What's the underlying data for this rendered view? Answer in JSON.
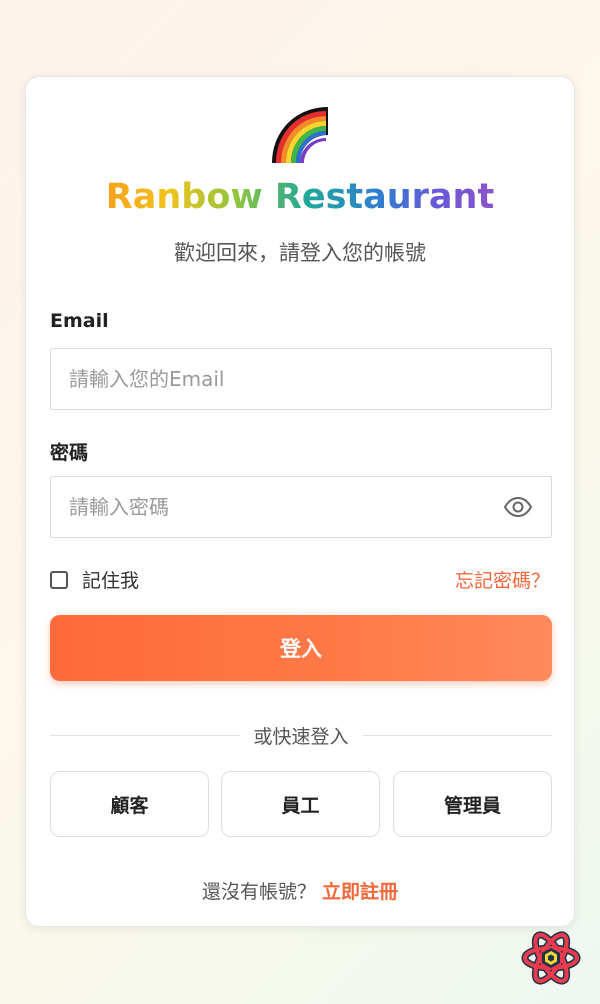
{
  "brand": {
    "name": "Ranbow Restaurant",
    "logo_icon": "rainbow-icon"
  },
  "login": {
    "subtitle": "歡迎回來，請登入您的帳號",
    "email_label": "Email",
    "email_placeholder": "請輸入您的Email",
    "email_value": "",
    "password_label": "密碼",
    "password_placeholder": "請輸入密碼",
    "password_value": "",
    "show_password_icon": "eye-icon",
    "remember_label": "記住我",
    "remember_checked": false,
    "forgot_label": "忘記密碼？",
    "submit_label": "登入"
  },
  "quick_login": {
    "divider_text": "或快速登入",
    "options": [
      {
        "label": "顧客"
      },
      {
        "label": "員工"
      },
      {
        "label": "管理員"
      }
    ]
  },
  "footer": {
    "prompt": "還沒有帳號？",
    "register_label": "立即註冊"
  },
  "badge": {
    "icon": "react-devtools-icon"
  },
  "colors": {
    "accent": "#f2673a",
    "button_start": "#ff6a3a",
    "button_end": "#ff8a5c",
    "background": "#fcf8ea"
  }
}
